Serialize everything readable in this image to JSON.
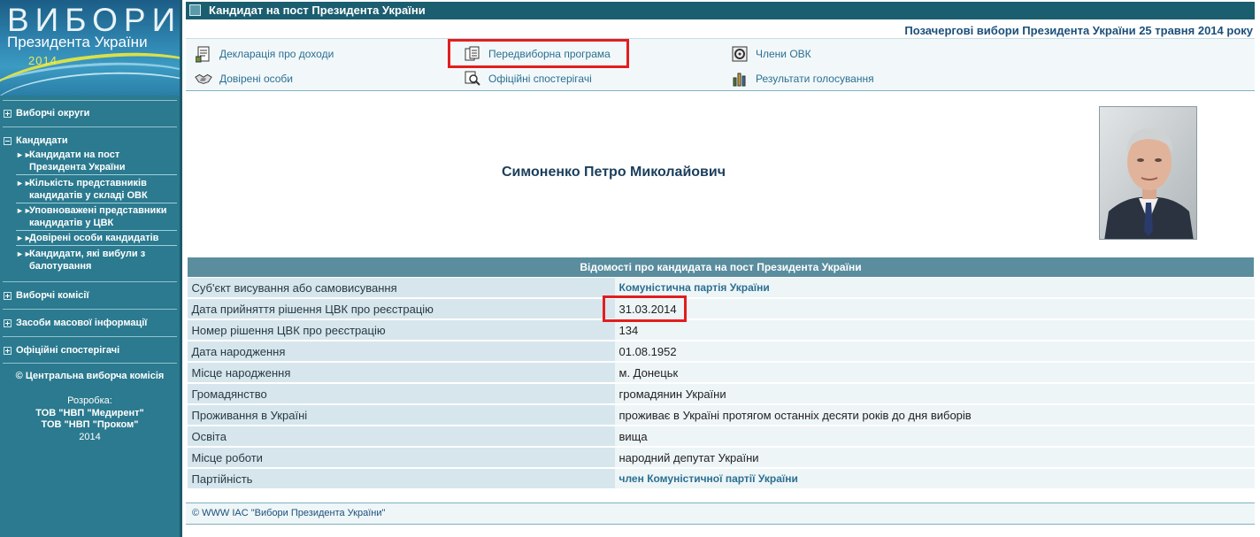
{
  "logo": {
    "line1": "ВИБОРИ",
    "line2": "Президента України",
    "line3": "2014"
  },
  "sidebar": {
    "sections": [
      {
        "label": "Виборчі округи"
      },
      {
        "label": "Кандидати"
      },
      {
        "label": "Виборчі комісії"
      },
      {
        "label": "Засоби масової інформації"
      },
      {
        "label": "Офіційні спостерігачі"
      }
    ],
    "candidates_items": [
      {
        "label": "Кандидати на пост Президента України"
      },
      {
        "label": "Кількість представників кандидатів у складі ОВК"
      },
      {
        "label": "Уповноважені представники кандидатів у ЦВК"
      },
      {
        "label": "Довірені особи кандидатів"
      },
      {
        "label": "Кандидати, які вибули з балотування"
      }
    ],
    "copyright": "© Центральна виборча комісія",
    "dev": {
      "label": "Розробка:",
      "org1": "ТОВ \"НВП \"Медирент\"",
      "org2": "ТОВ \"НВП \"Проком\"",
      "year": "2014"
    }
  },
  "header": {
    "title": "Кандидат на пост Президента України",
    "subtitle": "Позачергові вибори Президента України 25 травня 2014 року"
  },
  "menu": {
    "declaration": "Декларація про доходи",
    "program": "Передвиборна програма",
    "ovk_members": "Члени ОВК",
    "trusted": "Довірені особи",
    "observers": "Офіційні спостерігачі",
    "results": "Результати голосування"
  },
  "candidate": {
    "name": "Симоненко Петро Миколайович"
  },
  "info": {
    "title": "Відомості про кандидата на пост Президента України",
    "rows": [
      {
        "label": "Суб'єкт висування або самовисування",
        "value": "Комуністична партія України"
      },
      {
        "label": "Дата прийняття рішення ЦВК про реєстрацію",
        "value": "31.03.2014"
      },
      {
        "label": "Номер рішення ЦВК про реєстрацію",
        "value": "134"
      },
      {
        "label": "Дата народження",
        "value": "01.08.1952"
      },
      {
        "label": "Місце народження",
        "value": "м. Донецьк"
      },
      {
        "label": "Громадянство",
        "value": "громадянин України"
      },
      {
        "label": "Проживання в Україні",
        "value": "проживає в Україні протягом останніх десяти років до дня виборів"
      },
      {
        "label": "Освіта",
        "value": "вища"
      },
      {
        "label": "Місце роботи",
        "value": "народний депутат України"
      },
      {
        "label": "Партійність",
        "value": "член Комуністичної партії України"
      }
    ]
  },
  "footer": {
    "text": "© WWW IAC \"Вибори Президента України\""
  },
  "colors": {
    "sidebar": "#2b7a8f",
    "title_bar": "#1b5e70",
    "highlight": "#e21e1e",
    "link": "#2b6f91"
  }
}
